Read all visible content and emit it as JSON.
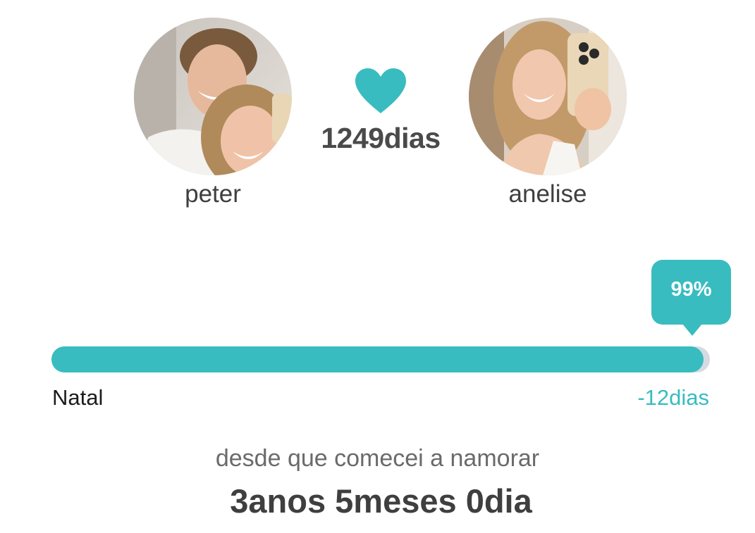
{
  "couple": {
    "left": {
      "name": "peter"
    },
    "right": {
      "name": "anelise"
    },
    "days_together": "1249dias"
  },
  "progress": {
    "percent_label": "99%",
    "fraction": 0.99,
    "event_name": "Natal",
    "countdown": "-12dias"
  },
  "summary": {
    "since_label": "desde que comecei a namorar",
    "duration": "3anos 5meses 0dia"
  },
  "colors": {
    "accent": "#38bcc0",
    "track": "#d5dbe0",
    "text_dark": "#3f3f3f"
  },
  "icons": {
    "heart": "heart-icon"
  }
}
